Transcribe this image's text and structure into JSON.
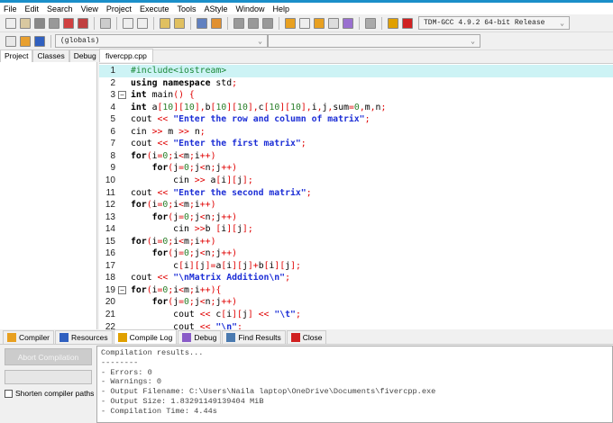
{
  "menu": [
    "File",
    "Edit",
    "Search",
    "View",
    "Project",
    "Execute",
    "Tools",
    "AStyle",
    "Window",
    "Help"
  ],
  "toolbar": {
    "compiler_select": "TDM-GCC 4.9.2 64-bit Release",
    "globals_select": "(globals)",
    "member_select": ""
  },
  "left_tabs": [
    "Project",
    "Classes",
    "Debug"
  ],
  "editor_tab": "fivercpp.cpp",
  "code_lines": [
    "#include<iostream>",
    "using namespace std;",
    "int main() {",
    "int a[10][10],b[10][10],c[10][10],i,j,sum=0,m,n;",
    "cout << \"Enter the row and column of matrix\";",
    "cin >> m >> n;",
    "cout << \"Enter the first matrix\";",
    "for(i=0;i<m;i++)",
    "    for(j=0;j<n;j++)",
    "        cin >> a[i][j];",
    "cout << \"Enter the second matrix\";",
    "for(i=0;i<m;i++)",
    "    for(j=0;j<n;j++)",
    "        cin >>b [i][j];",
    "for(i=0;i<m;i++)",
    "    for(j=0;j<n;j++)",
    "        c[i][j]=a[i][j]+b[i][j];",
    "cout << \"\\nMatrix Addition\\n\";",
    "for(i=0;i<m;i++){",
    "    for(j=0;j<n;j++)",
    "        cout << c[i][j] << \"\\t\";",
    "        cout << \"\\n\";"
  ],
  "fold_lines": [
    3,
    19
  ],
  "current_line": 1,
  "bottom_tabs": [
    {
      "label": "Compiler",
      "icon": "grid-icon",
      "color": "#e8a020"
    },
    {
      "label": "Resources",
      "icon": "resources-icon",
      "color": "#3060c0"
    },
    {
      "label": "Compile Log",
      "icon": "bar-chart-icon",
      "color": "#e0a000",
      "active": true
    },
    {
      "label": "Debug",
      "icon": "check-icon",
      "color": "#8a5cc8"
    },
    {
      "label": "Find Results",
      "icon": "find-icon",
      "color": "#4a7ab0"
    },
    {
      "label": "Close",
      "icon": "close-icon",
      "color": "#d02020"
    }
  ],
  "abort_button": "Abort Compilation",
  "shorten_paths_label": "Shorten compiler paths",
  "shorten_paths_checked": false,
  "log": [
    "Compilation results...",
    "--------",
    "- Errors: 0",
    "- Warnings: 0",
    "- Output Filename: C:\\Users\\Naila laptop\\OneDrive\\Documents\\fivercpp.exe",
    "- Output Size: 1.83291149139404 MiB",
    "- Compilation Time: 4.44s"
  ]
}
